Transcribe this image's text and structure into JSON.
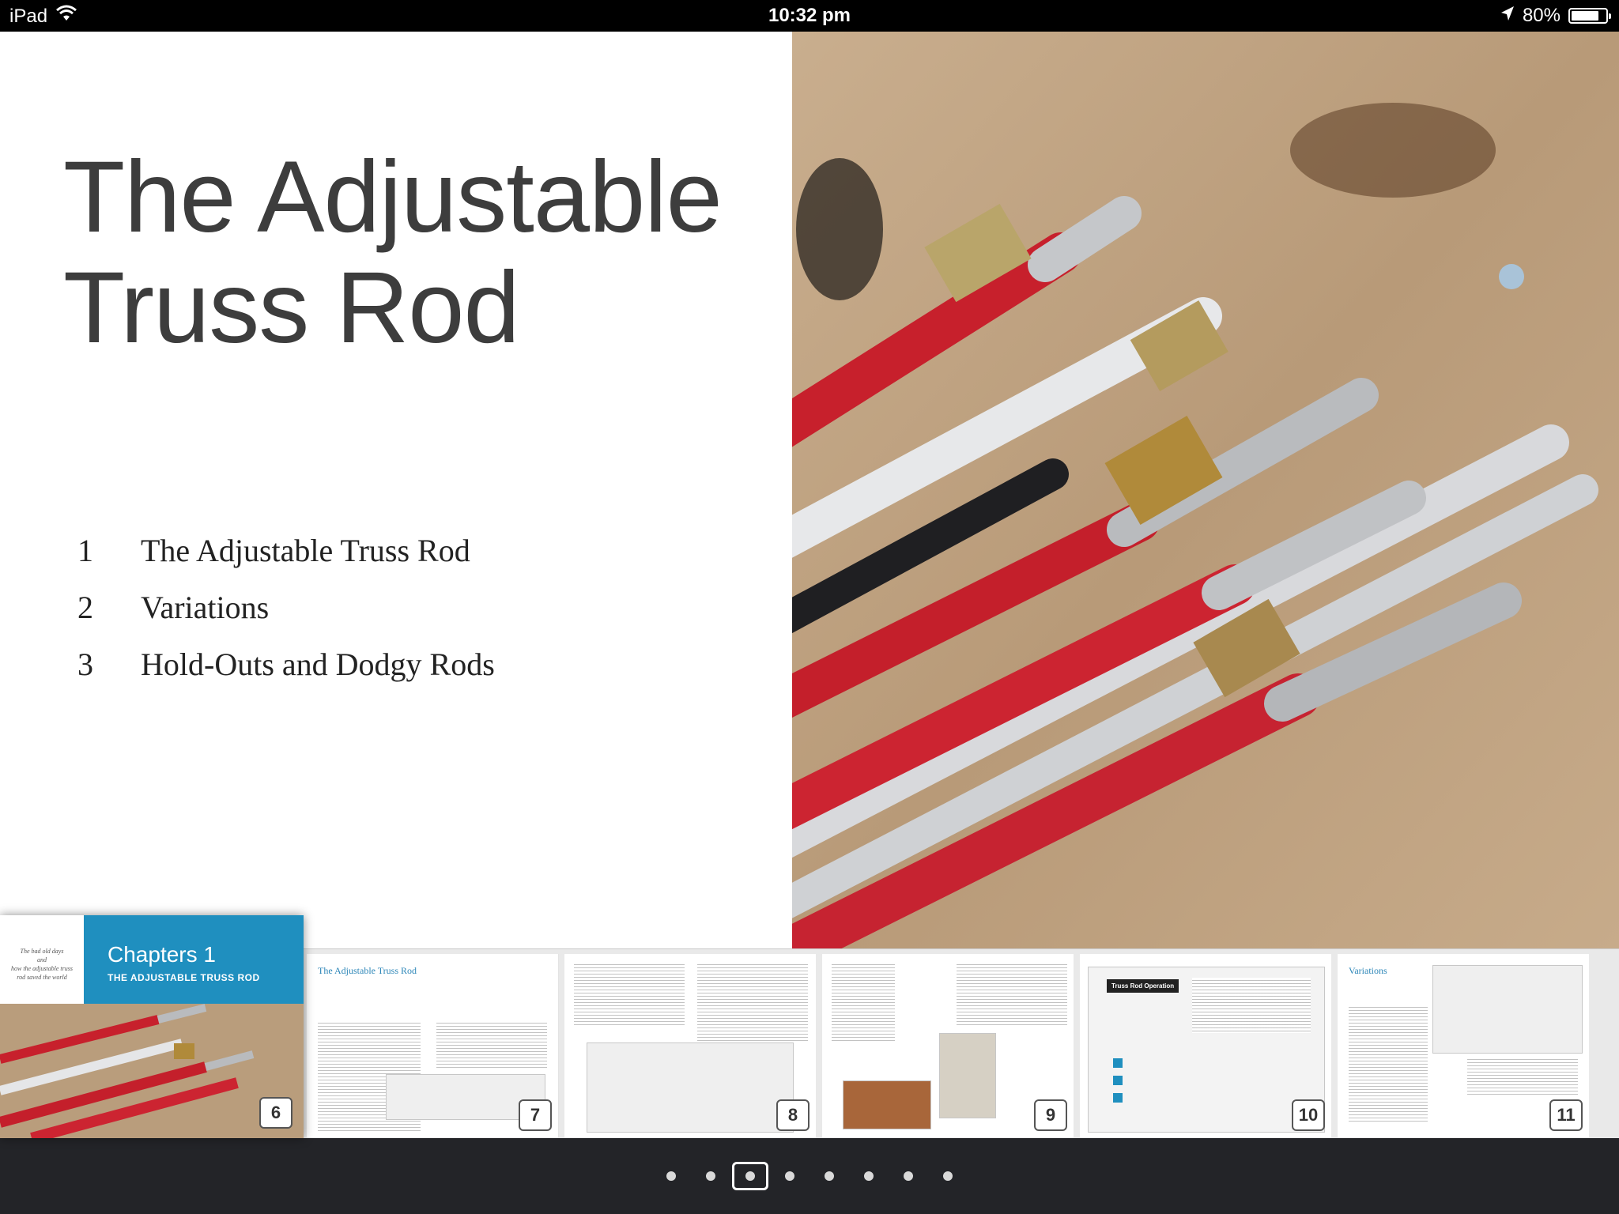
{
  "status_bar": {
    "device": "iPad",
    "time": "10:32 pm",
    "battery": "80%",
    "battery_level": 0.8
  },
  "page": {
    "title_line1": "The Adjustable",
    "title_line2": "Truss Rod",
    "toc": [
      {
        "number": "1",
        "label": "The Adjustable Truss Rod"
      },
      {
        "number": "2",
        "label": "Variations"
      },
      {
        "number": "3",
        "label": "Hold-Outs and Dodgy Rods"
      }
    ],
    "photo_icon": "truss-rods-photo"
  },
  "thumbnails": {
    "current": {
      "quote_line1": "The bad old days",
      "quote_line2": "and",
      "quote_line3": "how the adjustable truss",
      "quote_line4": "rod saved the world",
      "chapters_label": "Chapters 1",
      "chapter_title": "THE ADJUSTABLE TRUSS ROD",
      "page_number": "6"
    },
    "pages": [
      {
        "number": "7",
        "heading": "The Adjustable Truss Rod"
      },
      {
        "number": "8",
        "heading": ""
      },
      {
        "number": "9",
        "heading": ""
      },
      {
        "number": "10",
        "heading": "Truss Rod Operation"
      },
      {
        "number": "11",
        "heading": "Variations"
      }
    ]
  },
  "page_control": {
    "total": 8,
    "current_index": 2
  },
  "colors": {
    "chapter_blue": "#1f8fbf",
    "title_gray": "#3d3d3d",
    "dock": "#232428"
  }
}
